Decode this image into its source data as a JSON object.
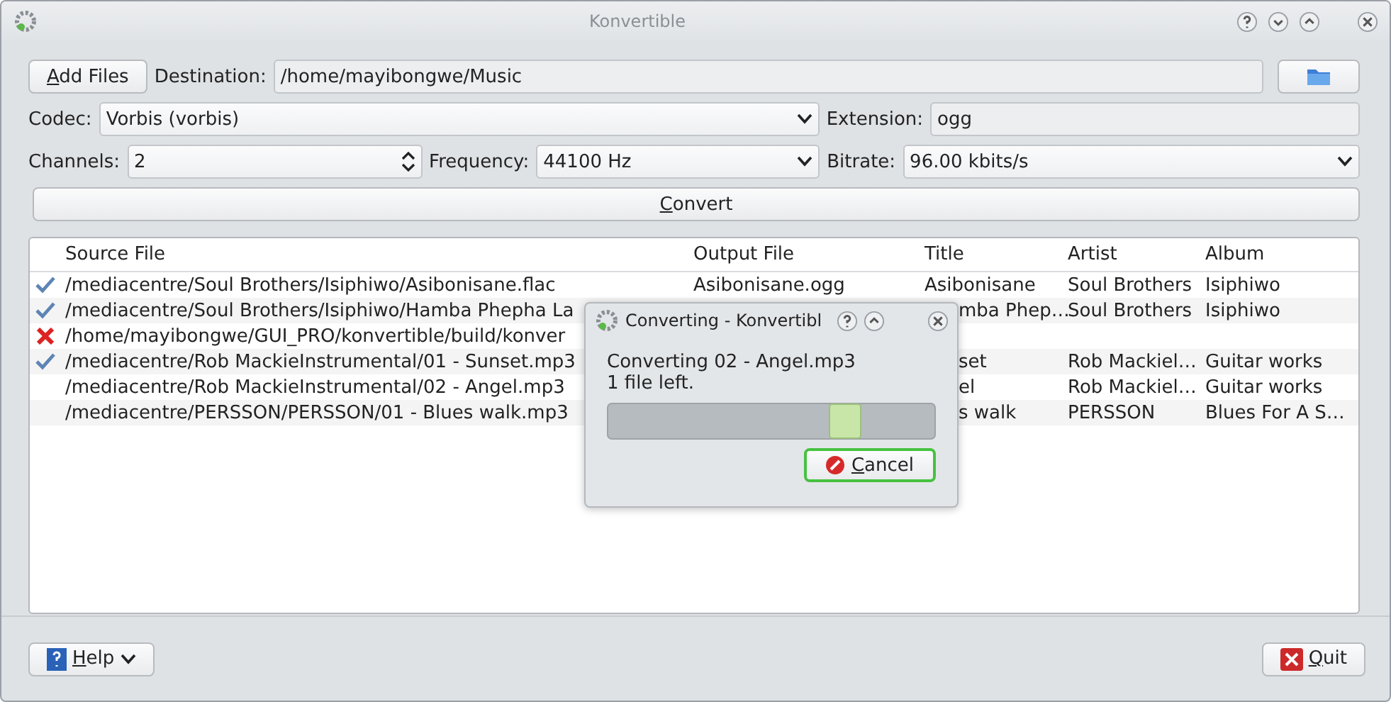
{
  "window": {
    "title": "Konvertible"
  },
  "add_files_button": {
    "label": "Add Files"
  },
  "destination": {
    "label": "Destination:",
    "value": "/home/mayibongwe/Music"
  },
  "codec": {
    "label": "Codec:",
    "value": "Vorbis (vorbis)"
  },
  "extension": {
    "label": "Extension:",
    "value": "ogg"
  },
  "channels": {
    "label": "Channels:",
    "value": "2"
  },
  "frequency": {
    "label": "Frequency:",
    "value": "44100 Hz"
  },
  "bitrate": {
    "label": "Bitrate:",
    "value": "96.00 kbits/s"
  },
  "convert_button": {
    "label": "Convert"
  },
  "table": {
    "columns": [
      "Source File",
      "Output File",
      "Title",
      "Artist",
      "Album"
    ],
    "rows": [
      {
        "kind": "done",
        "covered": false,
        "cells": [
          "/mediacentre/Soul Brothers/Isiphiwo/Asibonisane.flac",
          "Asibonisane.ogg",
          "Asibonisane",
          "Soul Brothers",
          "Isiphiwo"
        ]
      },
      {
        "kind": "done",
        "covered": true,
        "cells": [
          "/mediacentre/Soul Brothers/Isiphiwo/Hamba Phepha La",
          "",
          "mba Phep…",
          "Soul Brothers",
          "Isiphiwo"
        ]
      },
      {
        "kind": "failed",
        "cells": [
          "/home/mayibongwe/GUI_PRO/konvertible/build/konver",
          "",
          "",
          "",
          ""
        ]
      },
      {
        "kind": "done",
        "covered": true,
        "cells": [
          "/mediacentre/Rob MackieInstrumental/01 - Sunset.mp3",
          "",
          "set",
          "Rob Mackiel…",
          "Guitar works"
        ]
      },
      {
        "kind": "pending",
        "covered": true,
        "cells": [
          "/mediacentre/Rob MackieInstrumental/02 - Angel.mp3",
          "",
          "el",
          "Rob Mackiel…",
          "Guitar works"
        ]
      },
      {
        "kind": "pending",
        "covered": true,
        "cells": [
          "/mediacentre/PERSSON/PERSSON/01 - Blues walk.mp3",
          "",
          "s walk",
          "PERSSON",
          "Blues For A S…"
        ]
      }
    ]
  },
  "dialog": {
    "title": "Converting - Konvertibl",
    "message": "Converting 02 - Angel.mp3",
    "remaining": "1 file left.",
    "cancel_button": "Cancel"
  },
  "help_button": {
    "label": "Help"
  },
  "quit_button": {
    "label": "Quit"
  }
}
